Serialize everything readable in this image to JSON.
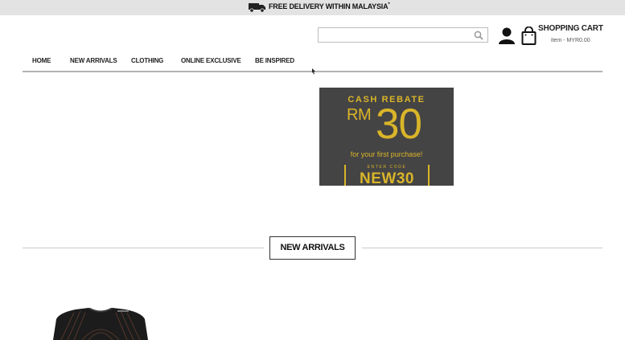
{
  "announcement": {
    "text": "FREE DELIVERY WITHIN MALAYSIA",
    "superscript": "*",
    "icon": "truck-icon"
  },
  "search": {
    "value": "",
    "placeholder": "",
    "icon": "search-icon"
  },
  "header": {
    "account_icon": "user-icon",
    "cart_icon": "shopping-bag-icon",
    "cart_title": "SHOPPING CART",
    "cart_summary": "item - MYR0.00"
  },
  "nav": {
    "items": [
      "HOME",
      "NEW ARRIVALS",
      "CLOTHING",
      "ONLINE EXCLUSIVE",
      "BE INSPIRED"
    ]
  },
  "banner": {
    "line1": "CASH REBATE",
    "currency": "RM",
    "amount": "30",
    "line3": "for your first purchase!",
    "code_label": "ENTER CODE",
    "code": "NEW30"
  },
  "section": {
    "title": "NEW ARRIVALS"
  },
  "colors": {
    "topbar_bg": "#e3e3e3",
    "banner_bg": "#454444",
    "banner_gold": "#d9b529",
    "nav_rule": "#b3b3b3"
  }
}
